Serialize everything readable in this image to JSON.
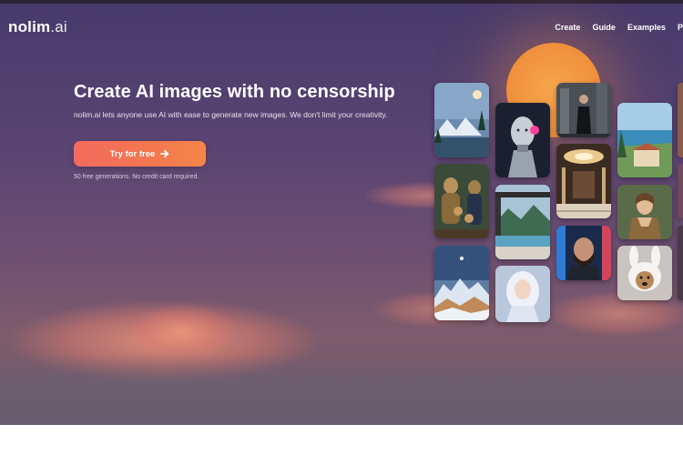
{
  "brand": {
    "name": "nolim",
    "suffix": ".ai"
  },
  "nav": {
    "items": [
      {
        "label": "Create"
      },
      {
        "label": "Guide"
      },
      {
        "label": "Examples"
      },
      {
        "label": "P"
      }
    ]
  },
  "hero": {
    "headline": "Create AI images with no censorship",
    "subheadline": "nolim.ai lets anyone use AI with ease to generate new images. We don't limit your creativity.",
    "cta_label": "Try for free",
    "cta_icon": "arrow-right-icon",
    "note": "50 free generations. No credit card required."
  },
  "gallery": {
    "images": [
      {
        "name": "mountain-lake-image"
      },
      {
        "name": "robot-woman-image"
      },
      {
        "name": "man-in-suit-city-image"
      },
      {
        "name": "coastal-villa-image"
      },
      {
        "name": "monkey-family-portrait-image"
      },
      {
        "name": "luxury-hall-image"
      },
      {
        "name": "modern-house-pool-image"
      },
      {
        "name": "renaissance-woman-image"
      },
      {
        "name": "bearded-man-neon-image"
      },
      {
        "name": "snowy-peaks-image"
      },
      {
        "name": "silver-hair-woman-image"
      },
      {
        "name": "dog-bunny-costume-image"
      }
    ]
  },
  "colors": {
    "cta_gradient_start": "#f26a5e",
    "cta_gradient_end": "#f5864a",
    "sun": "#f08f3c",
    "sky_top": "#463a6a"
  }
}
